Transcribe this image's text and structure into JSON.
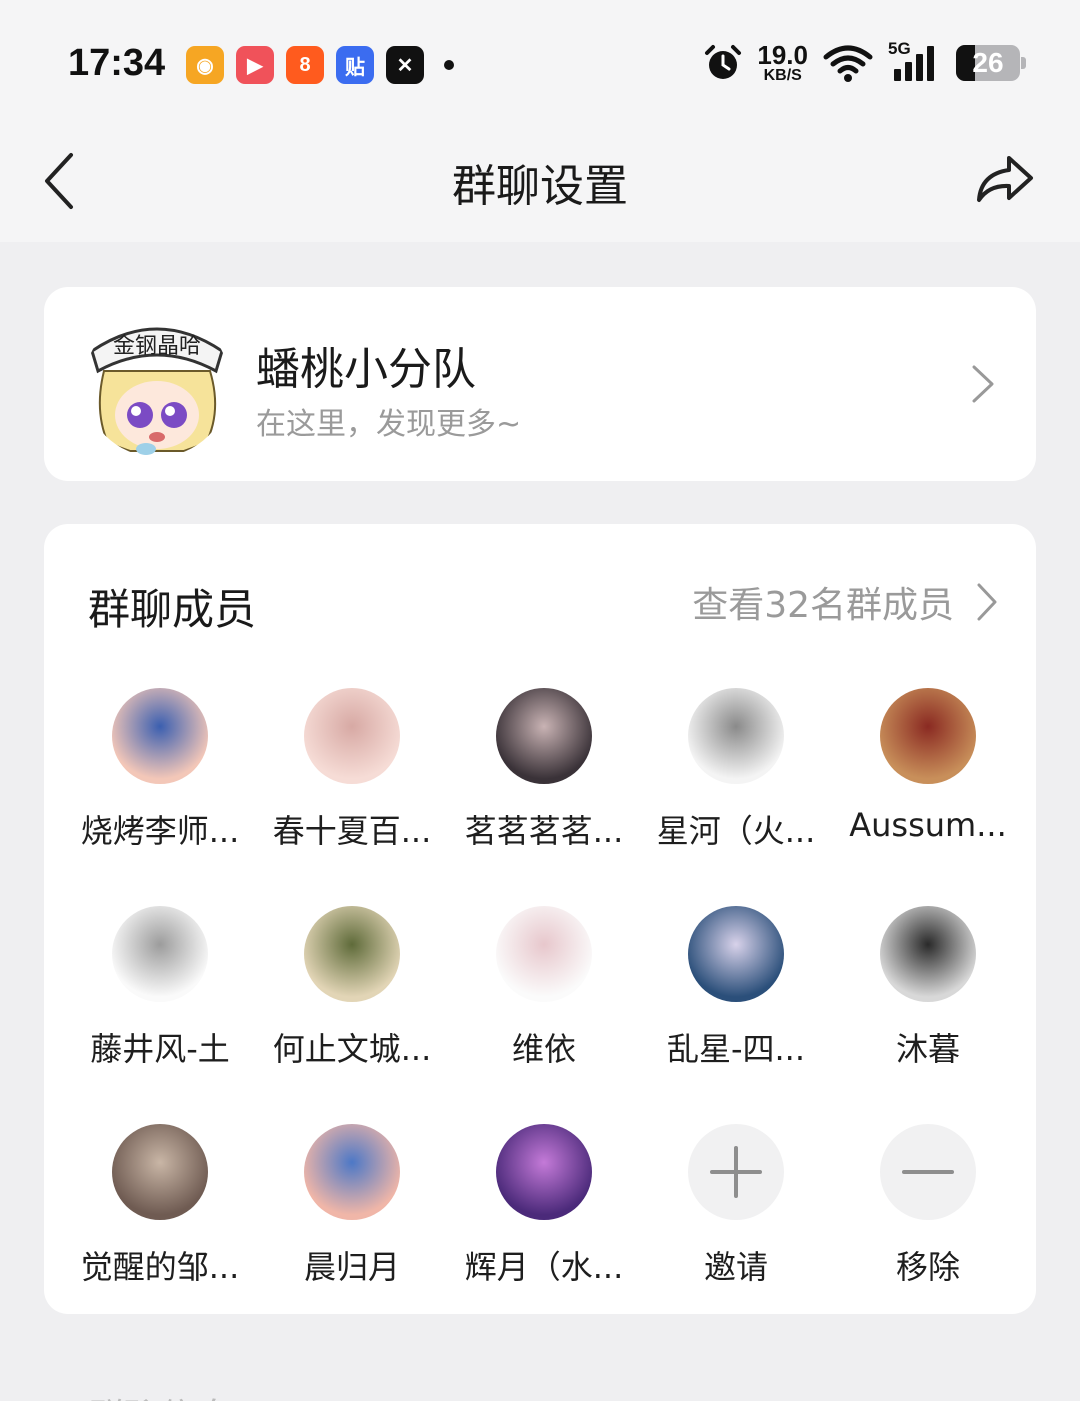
{
  "status_bar": {
    "time": "17:34",
    "apps": [
      {
        "name": "weibo-icon",
        "bg": "#f6a623",
        "glyph": "◉"
      },
      {
        "name": "video-app-icon",
        "bg": "#f0525a",
        "glyph": "▶"
      },
      {
        "name": "kuaishou-icon",
        "bg": "#ff5b1e",
        "glyph": "8"
      },
      {
        "name": "tieba-icon",
        "bg": "#3b6cf0",
        "glyph": "贴"
      },
      {
        "name": "capcut-icon",
        "bg": "#111111",
        "glyph": "✕"
      }
    ],
    "net_speed_value": "19.0",
    "net_speed_unit": "KB/S",
    "network": "5G",
    "battery": "26"
  },
  "nav": {
    "title": "群聊设置"
  },
  "group": {
    "name": "蟠桃小分队",
    "description": "在这里，发现更多~"
  },
  "members": {
    "title": "群聊成员",
    "view_all": "查看32名群成员",
    "list": [
      {
        "name": "烧烤李师...",
        "c1": "#f3c7b8",
        "c2": "#3b5fb0"
      },
      {
        "name": "春十夏百...",
        "c1": "#f6dcd6",
        "c2": "#d7a9a4"
      },
      {
        "name": "茗茗茗茗...",
        "c1": "#3a3238",
        "c2": "#c9b3b4"
      },
      {
        "name": "星河（火...",
        "c1": "#f4f4f4",
        "c2": "#8a8a8a"
      },
      {
        "name": "Aussum...",
        "c1": "#c88f5a",
        "c2": "#8a2a22"
      },
      {
        "name": "藤井风-土",
        "c1": "#fafafa",
        "c2": "#9c9c9c"
      },
      {
        "name": "何止文城...",
        "c1": "#e2d5b6",
        "c2": "#5f6b3a"
      },
      {
        "name": "维依",
        "c1": "#fbfbfb",
        "c2": "#e7c7cc"
      },
      {
        "name": "乱星-四...",
        "c1": "#2b4f7a",
        "c2": "#d8d2ea"
      },
      {
        "name": "沐暮",
        "c1": "#d8d8d8",
        "c2": "#2a2a2a"
      },
      {
        "name": "觉醒的邹...",
        "c1": "#6f5b52",
        "c2": "#c9b6a6"
      },
      {
        "name": "晨归月",
        "c1": "#f0b6a8",
        "c2": "#4d78c6"
      },
      {
        "name": "辉月（水...",
        "c1": "#4b2a7a",
        "c2": "#c47ad8"
      }
    ],
    "invite_label": "邀请",
    "remove_label": "移除"
  },
  "next_section_peek": "群聊信息"
}
